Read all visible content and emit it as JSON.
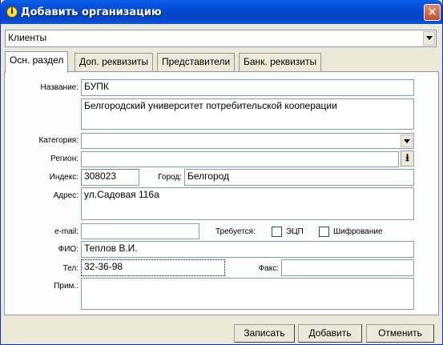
{
  "window": {
    "title": "Добавить организацию",
    "info_icon": "info-icon",
    "close_glyph": "✕"
  },
  "group_combo": {
    "value": "Клиенты"
  },
  "tabs": [
    {
      "label": "Осн. раздел",
      "active": true
    },
    {
      "label": "Доп. реквизиты"
    },
    {
      "label": "Представители"
    },
    {
      "label": "Банк. реквизиты"
    }
  ],
  "form": {
    "name_label": "Название:",
    "name_value": "БУПК",
    "full_name_value": "Белгородский университет потребительской кооперации",
    "category_label": "Категория:",
    "category_value": "",
    "region_label": "Регион:",
    "region_value": "",
    "region_button": "⭳",
    "index_label": "Индекс:",
    "index_value": "308023",
    "city_label": "Город:",
    "city_value": "Белгород",
    "address_label": "Адрес:",
    "address_value": "ул.Садовая 116а",
    "email_label": "e-mail:",
    "email_value": "",
    "required_label": "Требуется:",
    "ecp_label": "ЭЦП",
    "ecp_checked": false,
    "encryption_label": "Шифрование",
    "encryption_checked": false,
    "fio_label": "ФИО:",
    "fio_value": "Теплов В.И.",
    "tel_label": "Тел:",
    "tel_value": "32-36-98",
    "fax_label": "Факс:",
    "fax_value": "",
    "note_label": "Прим.:",
    "note_value": ""
  },
  "buttons": {
    "write": "Записать",
    "add": "Добавить",
    "cancel": "Отменить"
  }
}
